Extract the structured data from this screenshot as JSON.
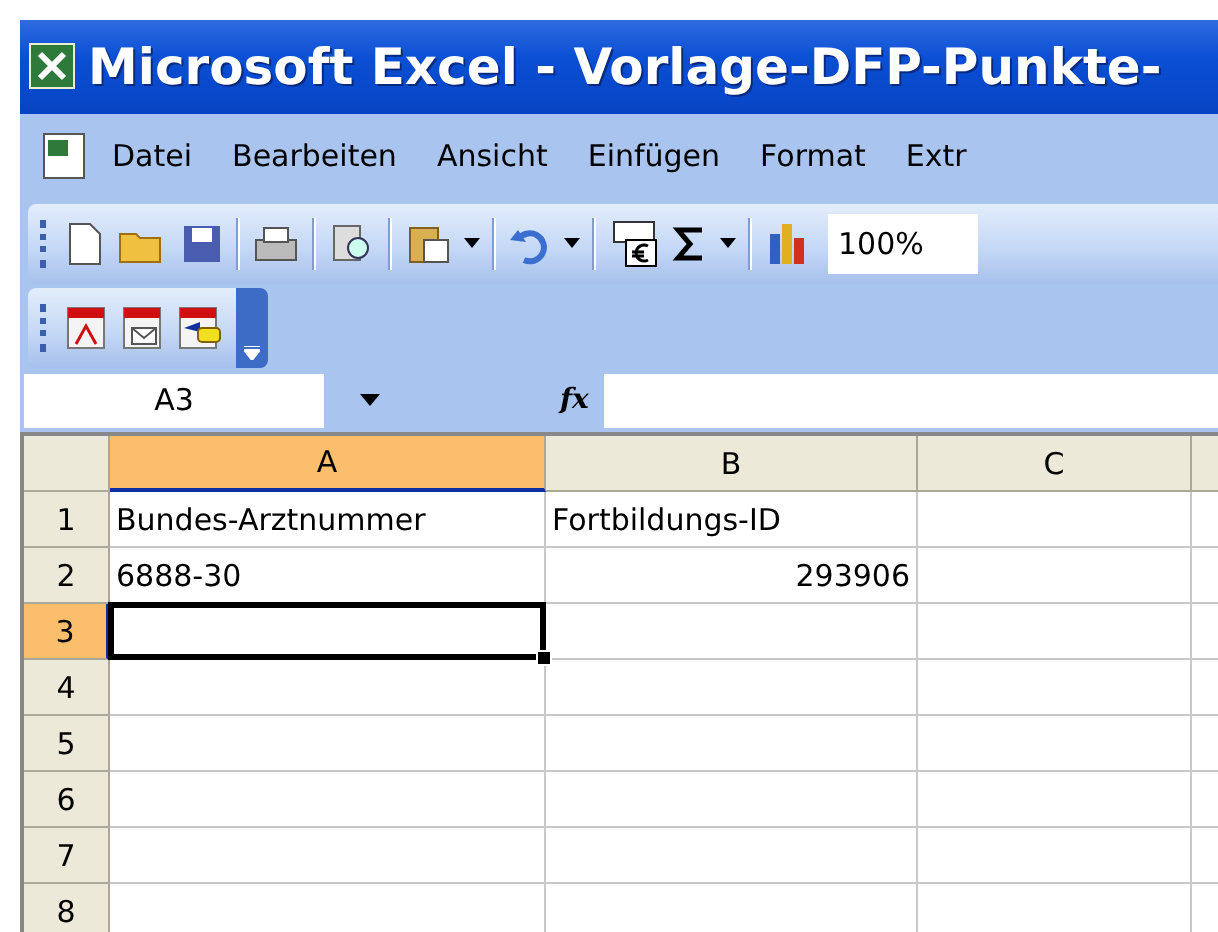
{
  "window": {
    "title": "Microsoft Excel - Vorlage-DFP-Punkte-"
  },
  "menu": [
    {
      "label": "Datei"
    },
    {
      "label": "Bearbeiten"
    },
    {
      "label": "Ansicht"
    },
    {
      "label": "Einfügen"
    },
    {
      "label": "Format"
    },
    {
      "label": "Extr"
    }
  ],
  "toolbar": {
    "zoom": "100%"
  },
  "formula_bar": {
    "name_box": "A3",
    "fx": "fx"
  },
  "sheet": {
    "columns": [
      {
        "label": "A",
        "selected": true
      },
      {
        "label": "B",
        "selected": false
      },
      {
        "label": "C",
        "selected": false
      },
      {
        "selected": false
      }
    ],
    "rows": [
      {
        "label": "1",
        "selected": false,
        "cells": [
          {
            "text": "Bundes-Arztnummer",
            "kind": "text",
            "selected": false
          },
          {
            "text": "Fortbildungs-ID",
            "kind": "text",
            "selected": false
          }
        ]
      },
      {
        "label": "2",
        "selected": false,
        "cells": [
          {
            "text": "6888-30",
            "kind": "text",
            "selected": false
          },
          {
            "text": "293906",
            "kind": "number",
            "selected": false
          }
        ]
      },
      {
        "label": "3",
        "selected": true,
        "cells": [
          {
            "selected": true
          }
        ]
      },
      {
        "label": "4",
        "selected": false,
        "cells": []
      },
      {
        "label": "5",
        "selected": false,
        "cells": []
      },
      {
        "label": "6",
        "selected": false,
        "cells": []
      },
      {
        "label": "7",
        "selected": false,
        "cells": []
      },
      {
        "label": "8",
        "selected": false,
        "cells": []
      }
    ]
  }
}
